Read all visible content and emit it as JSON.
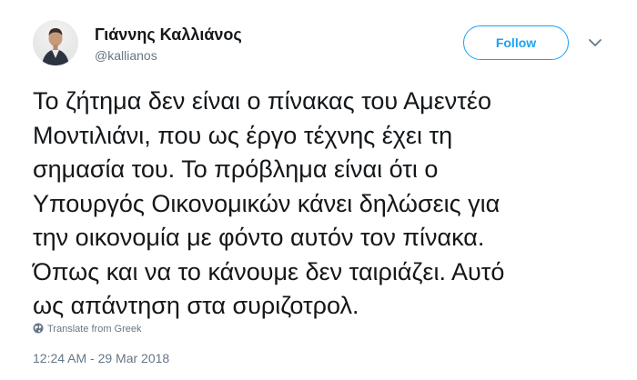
{
  "author": {
    "name": "Γιάννης Καλλιάνος",
    "handle": "@kallianos",
    "avatar_icon": "profile-photo"
  },
  "header": {
    "follow_label": "Follow",
    "menu_icon": "chevron-down-icon"
  },
  "tweet": {
    "lines": [
      "Το ζήτημα δεν είναι ο πίνακας του Αμεντέο",
      "Μοντιλιάνι, που ως έργο τέχνης έχει τη",
      "σημασία του. Το πρόβλημα είναι ότι ο",
      "Υπουργός Οικονομικών κάνει δηλώσεις για",
      "την οικονομία με φόντο αυτόν τον πίνακα.",
      "Όπως και να το κάνουμε δεν ταιριάζει. Αυτό",
      "ως απάντηση στα συριζοτρολ."
    ]
  },
  "translate": {
    "label": "Translate from Greek",
    "icon": "globe-icon"
  },
  "meta": {
    "timestamp": "12:24 AM - 29 Mar 2018"
  },
  "colors": {
    "accent": "#1da1f2",
    "text": "#14171a",
    "secondary": "#657786"
  }
}
